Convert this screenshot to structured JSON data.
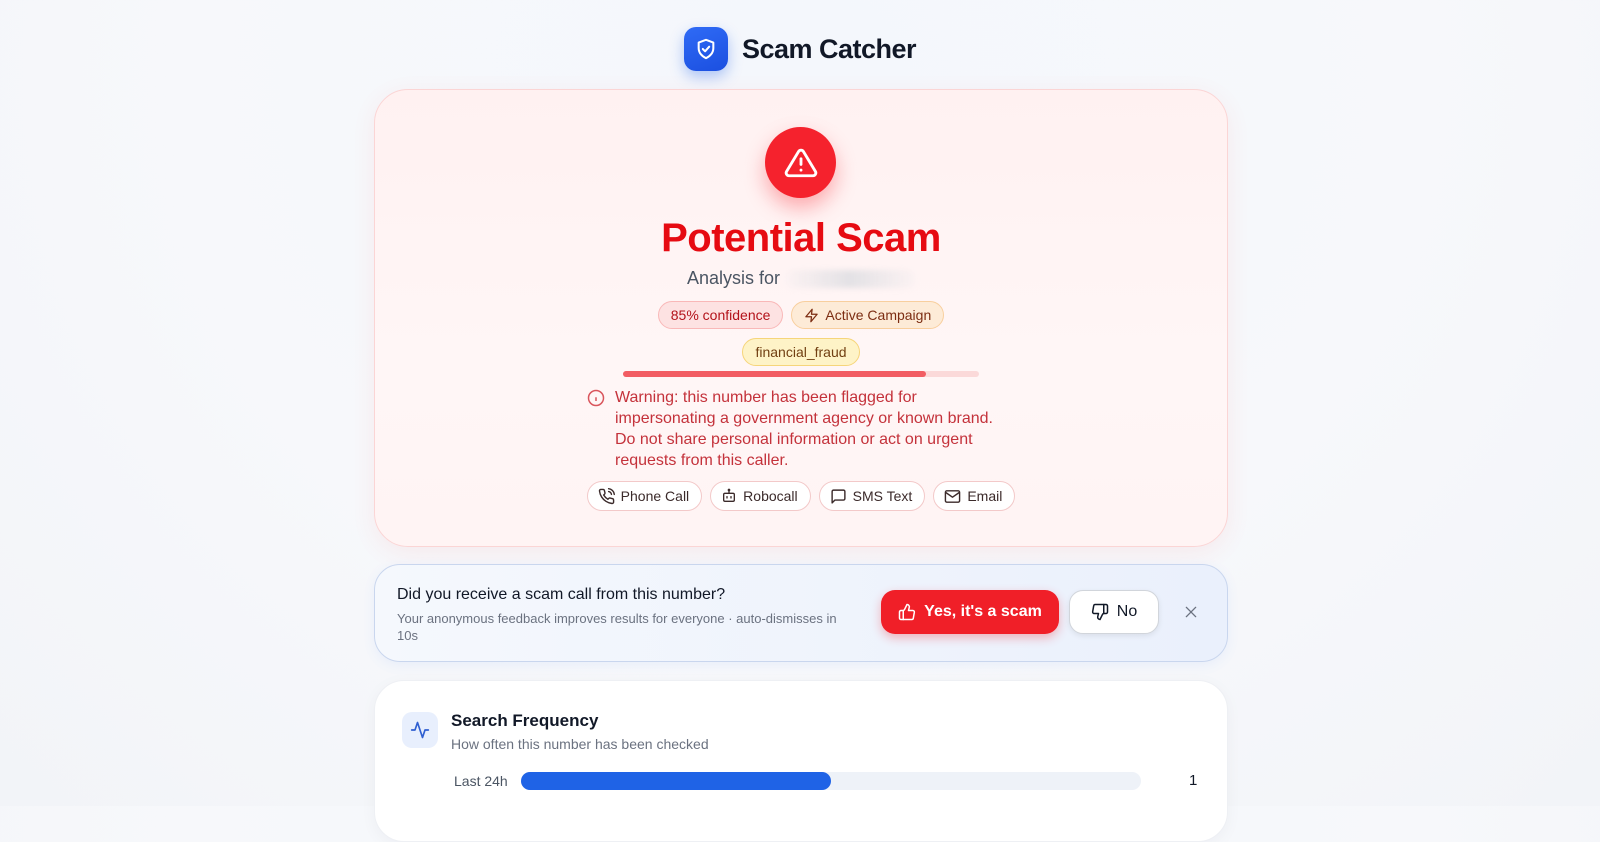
{
  "app": {
    "title": "Scam Catcher",
    "logo_icon": "shield-check-icon",
    "accent": "#1f63e6"
  },
  "result": {
    "verdict": "Potential Scam",
    "analysis_prefix": "Analysis for",
    "confidence_badge": "85% confidence",
    "confidence": 0.85,
    "campaign_badge": "Active Campaign",
    "category": "financial_fraud",
    "warning": "Warning: this number has been flagged for impersonating a government agency or known brand. Do not share personal information or act on urgent requests from this caller.",
    "channels": [
      {
        "label": "Phone Call",
        "icon": "phone-call-icon"
      },
      {
        "label": "Robocall",
        "icon": "bot-icon"
      },
      {
        "label": "SMS Text",
        "icon": "message-icon"
      },
      {
        "label": "Email",
        "icon": "mail-icon"
      }
    ],
    "colors": {
      "danger": "#e60b12"
    }
  },
  "feedback": {
    "question": "Did you receive a scam call from this number?",
    "subtext": "Your anonymous feedback improves results for everyone · auto-dismisses in 10s",
    "yes_label": "Yes, it's a scam",
    "no_label": "No"
  },
  "frequency": {
    "title": "Search Frequency",
    "subtitle": "How often this number has been checked",
    "rows": [
      {
        "label": "Last 24h",
        "count": "1",
        "fill": 0.5
      }
    ]
  }
}
